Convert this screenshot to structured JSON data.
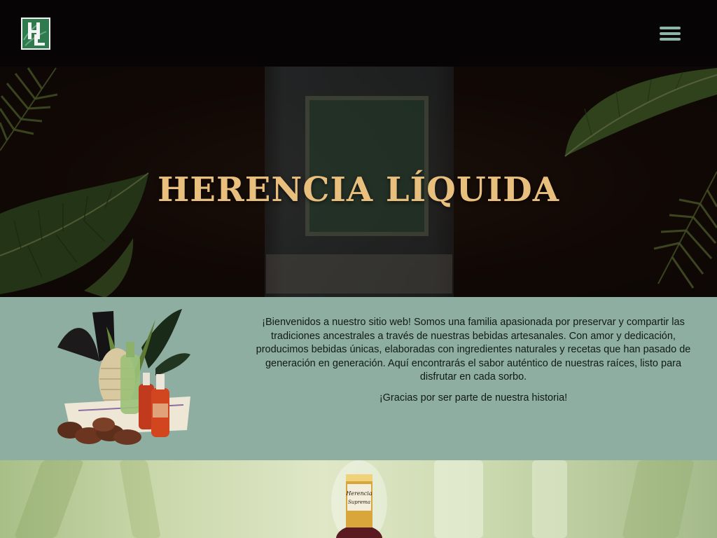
{
  "header": {
    "logo_alt": "HL",
    "menu_label": "menu"
  },
  "hero": {
    "title": "HERENCIA LÍQUIDA"
  },
  "intro": {
    "paragraph_1": "¡Bienvenidos a nuestro sitio web! Somos una familia apasionada por preservar y compartir las tradiciones ancestrales a través de nuestras bebidas artesanales. Con amor y dedicación, producimos bebidas únicas, elaboradas con ingredientes naturales y recetas que han pasado de generación en generación. Aquí encontrarás el sabor auténtico de nuestras raíces, listo para disfrutar en cada sorbo.",
    "paragraph_2": "¡Gracias por ser parte de nuestra historia!"
  },
  "colors": {
    "header_bg": "#060405",
    "title_gold": "#e9bf7e",
    "intro_bg": "#8eaea2",
    "menu_icon": "#8fb5a8",
    "logo_green": "#2f7a4f"
  }
}
